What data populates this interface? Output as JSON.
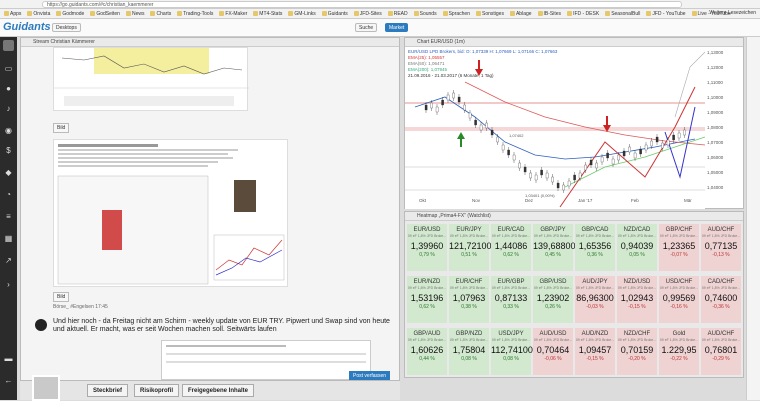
{
  "browser": {
    "url": "https://go.guidants.com/#c/christian_kaemmerer",
    "bookmarks": [
      "Apps",
      "Onvista",
      "Godmode",
      "GodSeiten",
      "News",
      "Charts",
      "Trading-Tools",
      "FX-Maker",
      "MT4-Stats",
      "GM-Links",
      "Guidants",
      "JFD-Sites",
      "READ",
      "Sounds",
      "Sprachen",
      "Sonstiges",
      "Ablage",
      "IB-Sites",
      "IFD - DESK",
      "SeasonalBull",
      "JFD - YouTube",
      "Live - YouTube"
    ],
    "other_bookmarks": "Weitere Lesezeichen"
  },
  "app": {
    "logo": "Guidants",
    "desktop_button": "Desktops",
    "search_button": "Suche",
    "market_button": "Market"
  },
  "stream": {
    "panel_title": "Stream Christian Kämmerer",
    "bild_label_1": "Bild",
    "bild_label_2": "Bild",
    "post_meta": "Börse_ #Engelsen 17:45",
    "post_text": "Und hier noch - da Freitag nicht am Schirm - weekly update von EUR TRY. Pipwert und Swap sind von heute und aktuell. Er macht, was er seit Wochen machen soll. Seitwärts laufen",
    "post_button": "Post verfassen"
  },
  "profile_tabs": [
    "Steckbrief",
    "Risikoprofil",
    "Freigegebene Inhalte"
  ],
  "chart": {
    "panel_title": "Chart EUR/USD (1m)",
    "legend": [
      "EUR/USD LPD Brokers, bid: O: 1,07339 H: 1,07669 L: 1,07166 C: 1,07663",
      "EMA(25): 1,05557",
      "EMA(50): 1,06471",
      "EMA(200): 1,07945",
      "21.09.2016 - 21.03.2017 (6 Monate, 1 Tag)"
    ],
    "price_axis": [
      "1,13000",
      "1,12000",
      "1,11000",
      "1,10000",
      "1,09000",
      "1,08000",
      "1,07000",
      "1,06000",
      "1,05000",
      "1,04000"
    ],
    "time_axis": [
      "Okt",
      "Nov",
      "Dez",
      "Jan '17",
      "Feb",
      "Mär"
    ],
    "annotation_1": "1,07402",
    "annotation_2": "1,03401 (0,00%)"
  },
  "heatmap": {
    "panel_title": "Heatmap „Prima4-FX\" (Watchlist)",
    "subline": "09 eF 1,8% JFD Broke...",
    "colors": {
      "up": "#d2e8cf",
      "down": "#efd3d3"
    },
    "cells": [
      {
        "name": "EUR/USD",
        "price": "1,39960",
        "change": "0,79 %",
        "dir": "up"
      },
      {
        "name": "EUR/JPY",
        "price": "121,72100",
        "change": "0,51 %",
        "dir": "up"
      },
      {
        "name": "EUR/CAD",
        "price": "1,44086",
        "change": "0,62 %",
        "dir": "up"
      },
      {
        "name": "GBP/JPY",
        "price": "139,68800",
        "change": "0,45 %",
        "dir": "up"
      },
      {
        "name": "GBP/CAD",
        "price": "1,65356",
        "change": "0,36 %",
        "dir": "up"
      },
      {
        "name": "NZD/CAD",
        "price": "0,94039",
        "change": "0,05 %",
        "dir": "up"
      },
      {
        "name": "GBP/CHF",
        "price": "1,23365",
        "change": "-0,07 %",
        "dir": "down"
      },
      {
        "name": "AUD/CHF",
        "price": "0,77135",
        "change": "-0,13 %",
        "dir": "down"
      },
      {
        "name": "EUR/NZD",
        "price": "1,53196",
        "change": "0,62 %",
        "dir": "up"
      },
      {
        "name": "EUR/CHF",
        "price": "1,07963",
        "change": "0,38 %",
        "dir": "up"
      },
      {
        "name": "EUR/GBP",
        "price": "0,87133",
        "change": "0,33 %",
        "dir": "up"
      },
      {
        "name": "GBP/USD",
        "price": "1,23902",
        "change": "0,26 %",
        "dir": "up"
      },
      {
        "name": "AUD/JPY",
        "price": "86,96300",
        "change": "-0,03 %",
        "dir": "down"
      },
      {
        "name": "NZD/USD",
        "price": "1,02943",
        "change": "-0,15 %",
        "dir": "down"
      },
      {
        "name": "USD/CHF",
        "price": "0,99569",
        "change": "-0,16 %",
        "dir": "down"
      },
      {
        "name": "CAD/CHF",
        "price": "0,74600",
        "change": "-0,36 %",
        "dir": "down"
      },
      {
        "name": "GBP/AUD",
        "price": "1,60626",
        "change": "0,44 %",
        "dir": "up"
      },
      {
        "name": "GBP/NZD",
        "price": "1,75804",
        "change": "0,08 %",
        "dir": "up"
      },
      {
        "name": "USD/JPY",
        "price": "112,74100",
        "change": "0,08 %",
        "dir": "up"
      },
      {
        "name": "AUD/USD",
        "price": "0,70464",
        "change": "-0,06 %",
        "dir": "down"
      },
      {
        "name": "AUD/NZD",
        "price": "1,09457",
        "change": "-0,15 %",
        "dir": "down"
      },
      {
        "name": "NZD/CHF",
        "price": "0,70159",
        "change": "-0,20 %",
        "dir": "down"
      },
      {
        "name": "Gold",
        "price": "1.229,95",
        "change": "-0,22 %",
        "dir": "down"
      },
      {
        "name": "AUD/CHF",
        "price": "0,76801",
        "change": "-0,29 %",
        "dir": "down"
      }
    ]
  }
}
